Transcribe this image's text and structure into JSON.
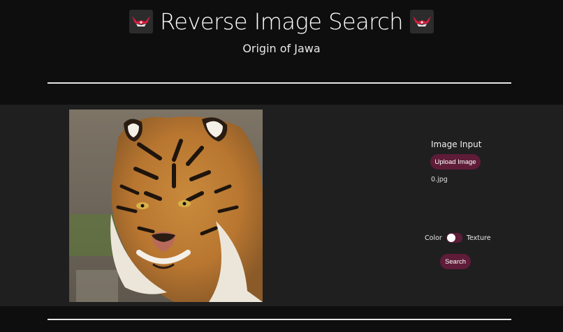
{
  "header": {
    "title": "Reverse Image Search",
    "subtitle": "Origin of Jawa",
    "logo_icon": "red-bird-logo-icon"
  },
  "image_input": {
    "label": "Image Input",
    "upload_label": "Upload Image",
    "filename": "0.jpg",
    "preview_subject": "tiger-photo"
  },
  "search_options": {
    "left_label": "Color",
    "right_label": "Texture",
    "toggle_state": "Color",
    "search_label": "Search"
  },
  "colors": {
    "accent": "#5e1c38",
    "background": "#0e0e0e",
    "panel": "#1f1f1f",
    "divider": "#e6e6e6"
  }
}
